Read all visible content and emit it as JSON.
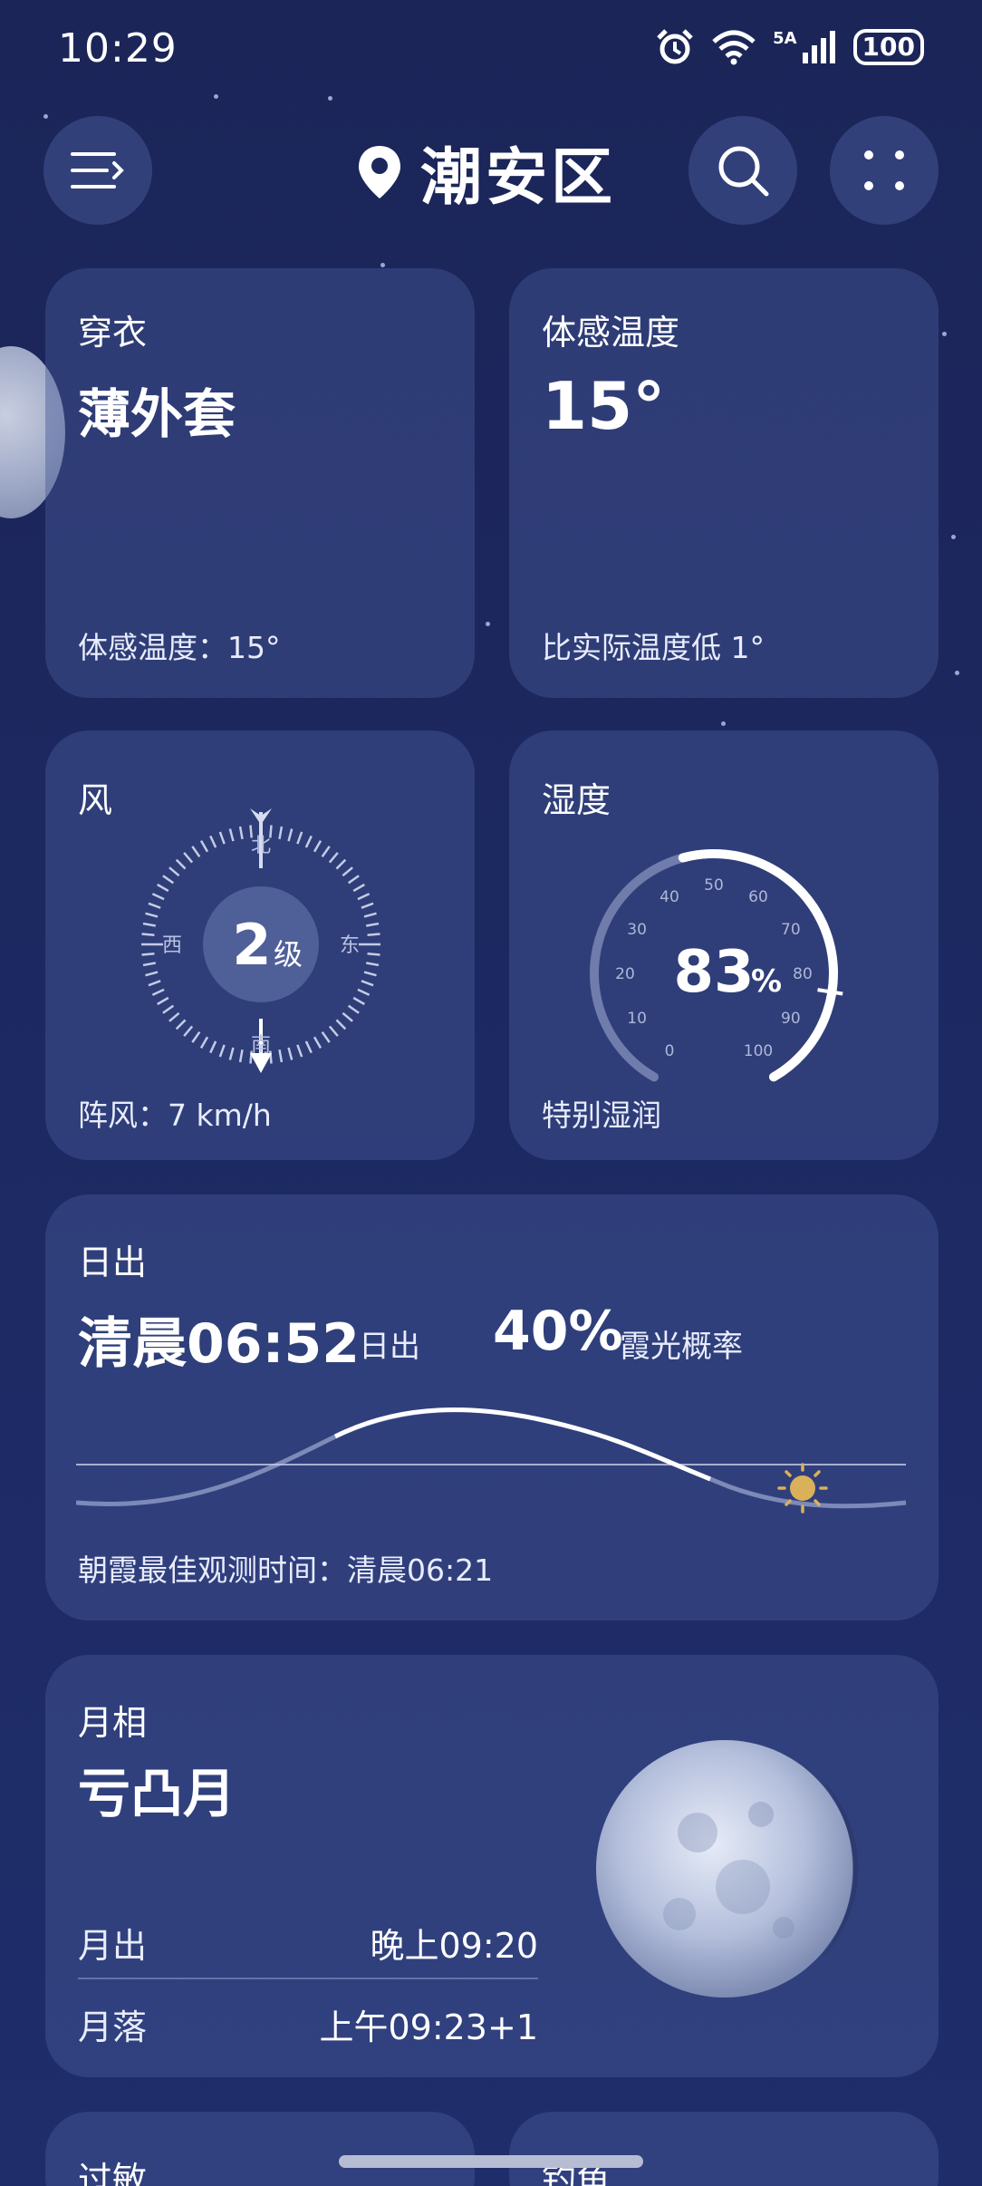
{
  "status_bar": {
    "time": "10:29",
    "network": "5A",
    "battery": "100"
  },
  "header": {
    "location": "潮安区"
  },
  "clothing": {
    "title": "穿衣",
    "value": "薄外套",
    "detail": "体感温度：15°"
  },
  "feels_like": {
    "title": "体感温度",
    "value": "15°",
    "detail": "比实际温度低 1°"
  },
  "wind": {
    "title": "风",
    "level_num": "2",
    "level_unit": "级",
    "north": "北",
    "south": "南",
    "east": "东",
    "west": "西",
    "gust": "阵风：7 km/h"
  },
  "humidity": {
    "title": "湿度",
    "value": "83",
    "unit": "%",
    "detail": "特别湿润",
    "level": 83,
    "ticks": [
      "0",
      "10",
      "20",
      "30",
      "40",
      "50",
      "60",
      "70",
      "80",
      "90",
      "100"
    ]
  },
  "sunrise": {
    "title": "日出",
    "time": "清晨06:52",
    "time_suffix": "日出",
    "probability": "40%",
    "probability_label": "霞光概率",
    "best_time": "朝霞最佳观测时间：清晨06:21"
  },
  "moon": {
    "title": "月相",
    "phase": "亏凸月",
    "rise_label": "月出",
    "rise_time": "晚上09:20",
    "set_label": "月落",
    "set_time": "上午09:23+1"
  },
  "bottom_cards": {
    "left_title": "过敏",
    "right_title": "钓鱼"
  },
  "colors": {
    "background": "#1c275e",
    "card": "#485896",
    "accent_sun": "#d9b15a"
  }
}
